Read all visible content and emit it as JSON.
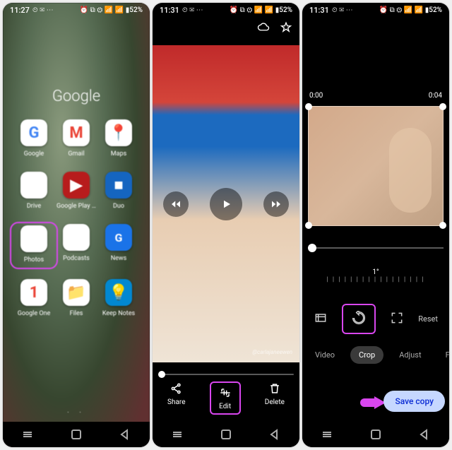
{
  "phone1": {
    "status": {
      "time": "11:27",
      "left_icons": "⏲ ✉ ⋯",
      "right_icons": "⏰ ⧉ ⚙ 📶 📶 ▮52%"
    },
    "folder_title": "Google",
    "apps": [
      {
        "label": "Google",
        "g": "G"
      },
      {
        "label": "Gmail",
        "g": "M"
      },
      {
        "label": "Maps",
        "g": "📍"
      },
      {
        "label": "Drive",
        "g": "◢"
      },
      {
        "label": "Google Play Mo...",
        "g": "▶"
      },
      {
        "label": "Duo",
        "g": "■"
      },
      {
        "label": "Photos",
        "g": "✿"
      },
      {
        "label": "Podcasts",
        "g": "⋮⋮"
      },
      {
        "label": "News",
        "g": "G"
      },
      {
        "label": "Google One",
        "g": "1"
      },
      {
        "label": "Files",
        "g": "📁"
      },
      {
        "label": "Keep Notes",
        "g": "💡"
      }
    ],
    "highlight_index": 6,
    "pager_dots": ". ."
  },
  "phone2": {
    "status": {
      "time": "11:31",
      "left_icons": "⏲ ✉ ⋯",
      "right_icons": "⏰ ⧉ ⚙ 📶 📶 ▮52%"
    },
    "top_icons": {
      "cloud": "cloud",
      "star": "star"
    },
    "watermark": "@carlajaneewen",
    "actions": {
      "share": "Share",
      "edit": "Edit",
      "delete": "Delete"
    },
    "highlight_action": "edit"
  },
  "phone3": {
    "status": {
      "time": "11:31",
      "left_icons": "⏲ ✉ ⋯",
      "right_icons": "⏰ ⧉ ⚙ 📶 📶 ▮52%"
    },
    "time_start": "0:00",
    "time_end": "0:04",
    "ruler_label": "1°",
    "reset_label": "Reset",
    "tabs": {
      "video": "Video",
      "crop": "Crop",
      "adjust": "Adjust",
      "filters": "Fil"
    },
    "active_tab": "crop",
    "highlight_tool": "rotate",
    "save_label": "Save copy"
  },
  "highlight_color": "#d946ef"
}
